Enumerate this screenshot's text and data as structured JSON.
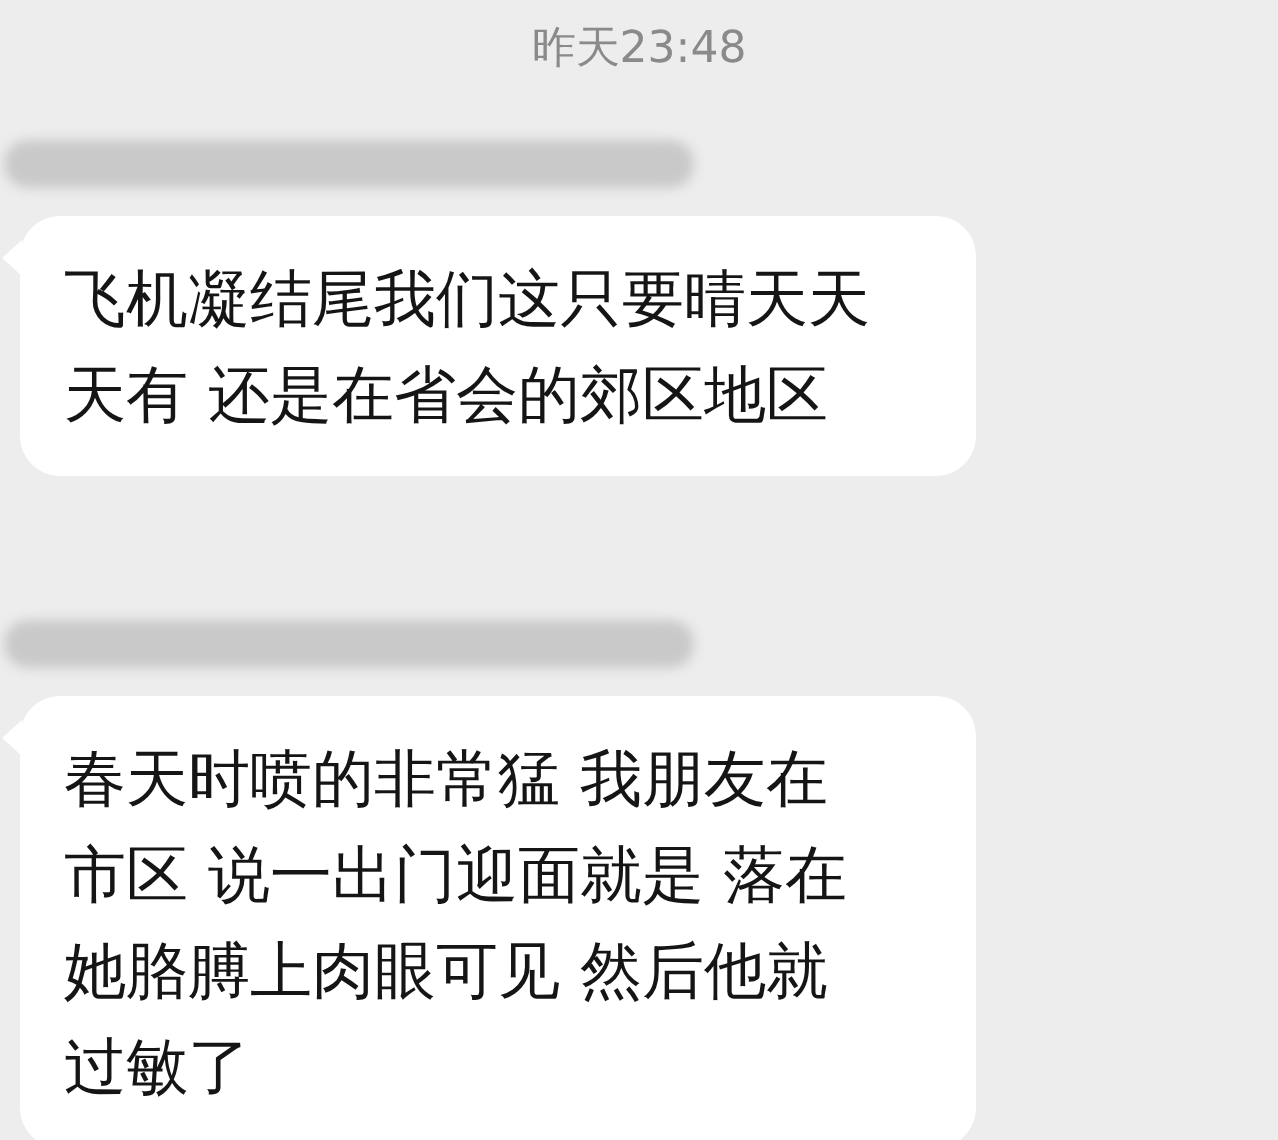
{
  "timestamp": "昨天23:48",
  "messages": [
    {
      "lines": [
        "飞机凝结尾我们这只要晴天天",
        "天有 还是在省会的郊区地区"
      ]
    },
    {
      "lines": [
        "春天时喷的非常猛 我朋友在",
        "市区 说一出门迎面就是 落在",
        "她胳膊上肉眼可见 然后他就",
        "过敏了"
      ]
    }
  ]
}
